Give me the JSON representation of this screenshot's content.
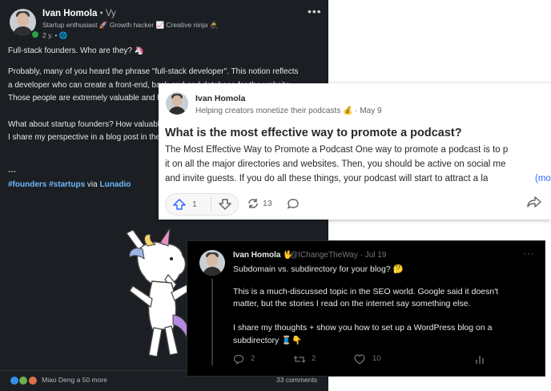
{
  "linkedin": {
    "author": "Ivan Homola",
    "degree": "• Vy",
    "headline": "Startup enthusiast 🚀 Growth hacker 📈 Creative ninja 🥷",
    "time": "2 y. • 🌐",
    "more": "•••",
    "lines": [
      "Full-stack founders. Who are they? 🦄",
      "Probably, many of you heard the phrase \"full-stack developer\". This notion reflects",
      "a developer who can create a front-end, back-end and database for the website.",
      "Those people are extremely valuable and hard to find.",
      "What about startup founders? How valuable are full-stack founders?",
      "I share my perspective in a blog post in the link below."
    ],
    "divider": "---",
    "hashtags": "#founders #startups",
    "via": "via",
    "via_link": "Lunadio",
    "reactions": "Miao Deng a 50 more",
    "comments": "33 comments",
    "colors": {
      "bg": "#1b1f23",
      "link": "#71b7fb"
    }
  },
  "quora": {
    "author": "Ivan Homola",
    "credential": "Helping creators monetize their podcasts 💰 · May 9",
    "title": "What is the most effective way to promote a podcast?",
    "body": [
      "The Most Effective Way to Promote a Podcast One way to promote a podcast is to p",
      "it on all the major directories and websites. Then, you should be active on social me",
      "and invite guests. If you do all these things, your podcast will start to attract a la"
    ],
    "more_link": "(mo",
    "upvotes": "1",
    "shares": "13",
    "icons": [
      "upvote-icon",
      "downvote-icon",
      "share-icon",
      "comment-icon",
      "forward-icon"
    ],
    "colors": {
      "accent": "#2e69ff"
    }
  },
  "twitter": {
    "author": "Ivan Homola 🖖",
    "handle": "@IChangeTheWay · Jul 19",
    "more": "···",
    "lines": [
      "Subdomain vs. subdirectory for your blog? 🤔",
      "This is a much-discussed topic in the SEO world. Google said it doesn't",
      "matter, but the stories I read on the internet say something else.",
      "I share my thoughts + show you how to set up a WordPress blog on a",
      "subdirectory 🧵👇"
    ],
    "replies": "2",
    "retweets": "2",
    "likes": "10",
    "icons": [
      "reply-icon",
      "retweet-icon",
      "like-icon",
      "analytics-icon"
    ],
    "colors": {
      "bg": "#000000",
      "muted": "#71767b"
    }
  }
}
